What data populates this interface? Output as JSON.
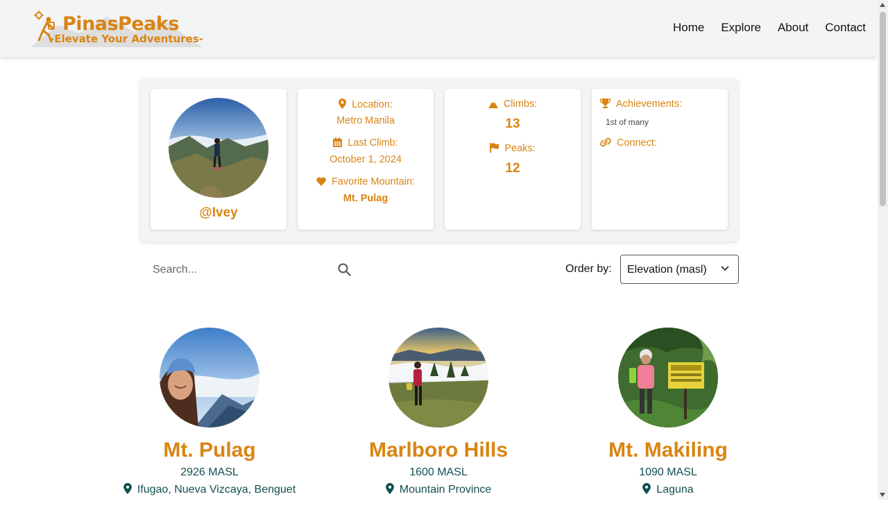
{
  "header": {
    "logo_title": "PinasPeaks",
    "logo_tagline": "-Elevate Your Adventures-",
    "nav": [
      "Home",
      "Explore",
      "About",
      "Contact"
    ]
  },
  "profile": {
    "username": "@Ivey",
    "location_label": "Location:",
    "location_value": "Metro Manila",
    "last_climb_label": "Last Climb:",
    "last_climb_value": "October 1, 2024",
    "favorite_label": "Favorite Mountain:",
    "favorite_value": "Mt. Pulag",
    "climbs_label": "Climbs:",
    "climbs_value": "13",
    "peaks_label": "Peaks:",
    "peaks_value": "12",
    "achievements_label": "Achievements:",
    "achievements_value": "1st of many",
    "connect_label": "Connect:"
  },
  "controls": {
    "search_placeholder": "Search...",
    "order_label": "Order by:",
    "order_value": "Elevation (masl)"
  },
  "mountains": [
    {
      "name": "Mt. Pulag",
      "elevation": "2926 MASL",
      "location": "Ifugao, Nueva Vizcaya, Benguet"
    },
    {
      "name": "Marlboro Hills",
      "elevation": "1600 MASL",
      "location": "Mountain Province"
    },
    {
      "name": "Mt. Makiling",
      "elevation": "1090 MASL",
      "location": "Laguna"
    }
  ],
  "colors": {
    "accent": "#d98412",
    "teal": "#124f4f",
    "panel": "#f3f4f6"
  },
  "icons": [
    "map-pin-icon",
    "calendar-icon",
    "heart-icon",
    "mountain-icon",
    "flag-icon",
    "trophy-icon",
    "link-icon",
    "search-icon",
    "chevron-down-icon"
  ]
}
